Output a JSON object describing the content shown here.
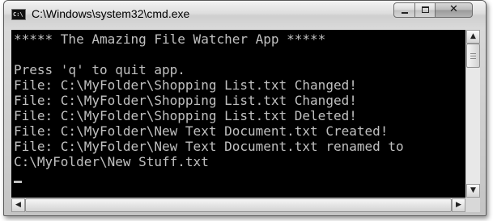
{
  "window": {
    "title": "C:\\Windows\\system32\\cmd.exe",
    "icon_text": "C:\\"
  },
  "title_controls": {
    "minimize_icon": "minimize-icon",
    "maximize_icon": "maximize-icon",
    "close_icon": "close-icon",
    "close_glyph": "✕"
  },
  "console": {
    "lines": [
      "***** The Amazing File Watcher App *****",
      "",
      "Press 'q' to quit app.",
      "File: C:\\MyFolder\\Shopping List.txt Changed!",
      "File: C:\\MyFolder\\Shopping List.txt Changed!",
      "File: C:\\MyFolder\\Shopping List.txt Deleted!",
      "File: C:\\MyFolder\\New Text Document.txt Created!",
      "File: C:\\MyFolder\\New Text Document.txt renamed to",
      "C:\\MyFolder\\New Stuff.txt"
    ],
    "text_color": "#c0c0c0",
    "background_color": "#000000"
  },
  "scrollbars": {
    "up_glyph": "▲",
    "down_glyph": "▼",
    "left_glyph": "◀",
    "right_glyph": "▶",
    "vertical_position": 0,
    "horizontal_position": 0
  }
}
